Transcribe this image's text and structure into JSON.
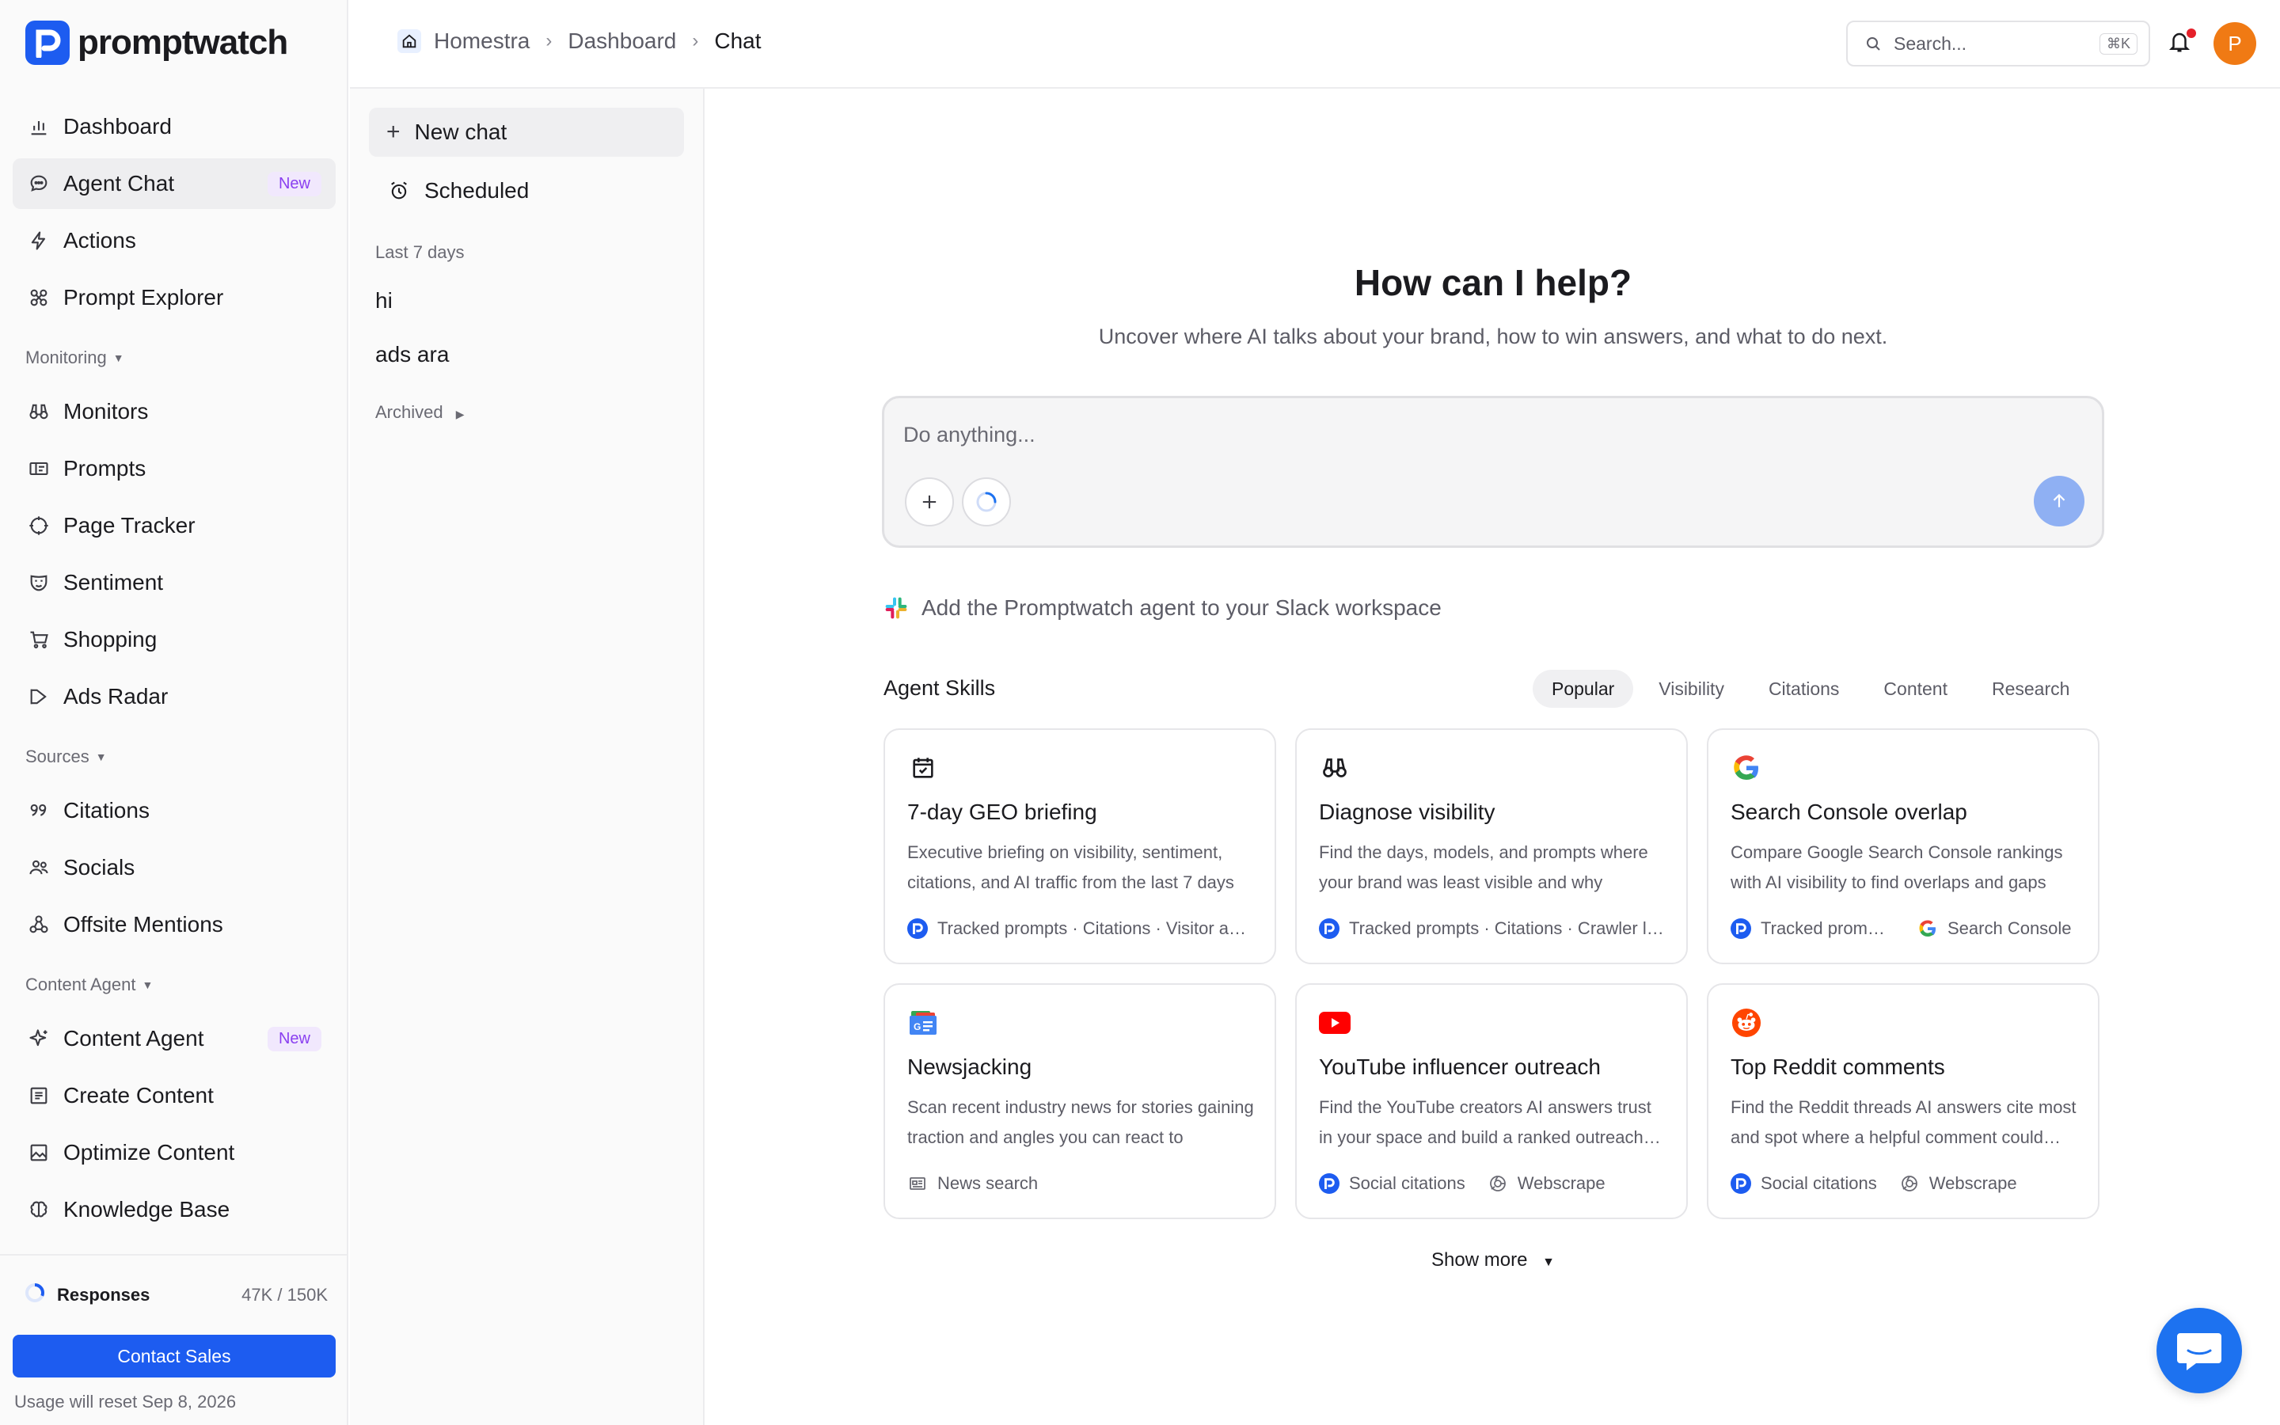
{
  "brand": {
    "name": "promptwatch",
    "color": "#1d5cf0"
  },
  "sidebar": {
    "items_top": [
      {
        "label": "Dashboard",
        "icon": "bar-chart-icon"
      },
      {
        "label": "Agent Chat",
        "icon": "chat-bubble-icon",
        "badge": "New",
        "active": true
      },
      {
        "label": "Actions",
        "icon": "lightning-icon"
      },
      {
        "label": "Prompt Explorer",
        "icon": "explorer-icon"
      }
    ],
    "monitoring_label": "Monitoring",
    "monitoring": [
      {
        "label": "Monitors",
        "icon": "binoculars-icon"
      },
      {
        "label": "Prompts",
        "icon": "prompt-icon"
      },
      {
        "label": "Page Tracker",
        "icon": "crosshair-icon"
      },
      {
        "label": "Sentiment",
        "icon": "mask-icon"
      },
      {
        "label": "Shopping",
        "icon": "cart-icon"
      },
      {
        "label": "Ads Radar",
        "icon": "megaphone-icon"
      }
    ],
    "sources_label": "Sources",
    "sources": [
      {
        "label": "Citations",
        "icon": "quote-icon"
      },
      {
        "label": "Socials",
        "icon": "people-icon"
      },
      {
        "label": "Offsite Mentions",
        "icon": "network-icon"
      }
    ],
    "content_label": "Content Agent",
    "content": [
      {
        "label": "Content Agent",
        "icon": "sparkle-icon",
        "badge": "New"
      },
      {
        "label": "Create Content",
        "icon": "document-icon"
      },
      {
        "label": "Optimize Content",
        "icon": "image-edit-icon"
      },
      {
        "label": "Knowledge Base",
        "icon": "brain-icon"
      }
    ],
    "usage": {
      "label": "Responses",
      "value": "47K / 150K",
      "used_fraction": 0.31
    },
    "contact_label": "Contact Sales",
    "reset_note": "Usage will reset Sep 8, 2026"
  },
  "chatlist": {
    "new_chat": "New chat",
    "scheduled": "Scheduled",
    "recent_label": "Last 7 days",
    "chats": [
      "hi",
      "ads ara"
    ],
    "archived_label": "Archived"
  },
  "header": {
    "crumbs": [
      "Homestra",
      "Dashboard",
      "Chat"
    ],
    "search_placeholder": "Search...",
    "search_shortcut": "⌘K",
    "avatar_initial": "P",
    "avatar_color": "#f07a14"
  },
  "main": {
    "title": "How can I help?",
    "subtitle": "Uncover where AI talks about your brand, how to win answers, and what to do next.",
    "composer_placeholder": "Do anything...",
    "slack_text": "Add the Promptwatch agent to your Slack workspace",
    "skills_title": "Agent Skills",
    "tabs": [
      "Popular",
      "Visibility",
      "Citations",
      "Content",
      "Research"
    ],
    "active_tab": "Popular",
    "cards": [
      {
        "title": "7-day GEO briefing",
        "desc": "Executive briefing on visibility, sentiment, citations, and AI traffic from the last 7 days",
        "icon": "calendar-check-icon",
        "sources": [
          {
            "icon": "promptwatch-icon",
            "text": "Tracked prompts · Citations · Visitor analytics"
          }
        ]
      },
      {
        "title": "Diagnose visibility",
        "desc": "Find the days, models, and prompts where your brand was least visible and why",
        "icon": "binoculars-icon",
        "sources": [
          {
            "icon": "promptwatch-icon",
            "text": "Tracked prompts · Citations · Crawler logs"
          }
        ]
      },
      {
        "title": "Search Console overlap",
        "desc": "Compare Google Search Console rankings with AI visibility to find overlaps and gaps",
        "icon": "google-icon",
        "sources": [
          {
            "icon": "promptwatch-icon",
            "text": "Tracked prompts"
          },
          {
            "icon": "google-icon",
            "text": "Search Console"
          }
        ]
      },
      {
        "title": "Newsjacking",
        "desc": "Scan recent industry news for stories gaining traction and angles you can react to",
        "icon": "google-news-icon",
        "sources": [
          {
            "icon": "newspaper-icon",
            "text": "News search"
          }
        ]
      },
      {
        "title": "YouTube influencer outreach",
        "desc": "Find the YouTube creators AI answers trust in your space and build a ranked outreach list",
        "icon": "youtube-icon",
        "sources": [
          {
            "icon": "promptwatch-icon",
            "text": "Social citations"
          },
          {
            "icon": "globe-icon",
            "text": "Webscrape"
          }
        ]
      },
      {
        "title": "Top Reddit comments",
        "desc": "Find the Reddit threads AI answers cite most and spot where a helpful comment could land",
        "icon": "reddit-icon",
        "sources": [
          {
            "icon": "promptwatch-icon",
            "text": "Social citations"
          },
          {
            "icon": "globe-icon",
            "text": "Webscrape"
          }
        ]
      }
    ],
    "show_more": "Show more"
  }
}
